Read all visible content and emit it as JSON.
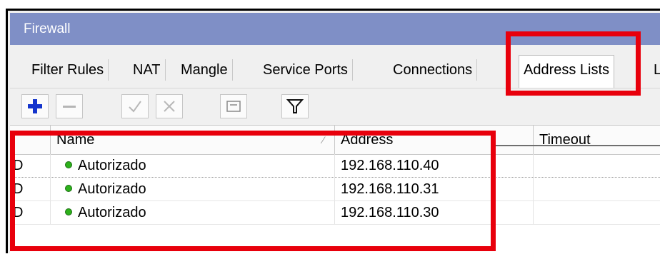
{
  "window": {
    "title": "Firewall"
  },
  "tabs": [
    {
      "label": "Filter Rules",
      "active": false
    },
    {
      "label": "NAT",
      "active": false
    },
    {
      "label": "Mangle",
      "active": false
    },
    {
      "label": "Service Ports",
      "active": false
    },
    {
      "label": "Connections",
      "active": false
    },
    {
      "label": "Address Lists",
      "active": true
    },
    {
      "label": "L",
      "active": false
    }
  ],
  "toolbar": {
    "buttons": [
      "add-icon",
      "remove-icon",
      "enable-icon",
      "disable-icon",
      "comment-icon",
      "filter-icon"
    ]
  },
  "table": {
    "columns": [
      "",
      "Name",
      "Address",
      "Timeout"
    ],
    "rows": [
      {
        "flag": "D",
        "name": "Autorizado",
        "address": "192.168.110.40",
        "timeout": ""
      },
      {
        "flag": "D",
        "name": "Autorizado",
        "address": "192.168.110.31",
        "timeout": ""
      },
      {
        "flag": "D",
        "name": "Autorizado",
        "address": "192.168.110.30",
        "timeout": ""
      }
    ]
  },
  "colors": {
    "title_bar": "#7f8fc6",
    "highlight": "#e8000c",
    "status_dot": "#2db11b",
    "add_icon": "#1434cc"
  }
}
